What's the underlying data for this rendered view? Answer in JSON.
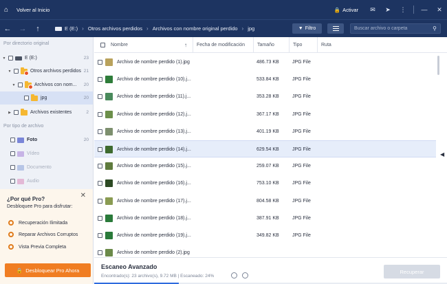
{
  "titlebar": {
    "title": "Volver al Inicio",
    "activate": "Activar"
  },
  "navbar": {
    "crumbs": [
      "E (E:)",
      "Otros archivos perdidos",
      "Archivos con nombre original perdido",
      "jpg"
    ],
    "filter_label": "Filtro",
    "search_placeholder": "Buscar archivo o carpeta"
  },
  "sidebar": {
    "section_original": "Por directorio original",
    "tree": [
      {
        "label": "E (E:)",
        "count": "23"
      },
      {
        "label": "Otros archivos perdidos",
        "count": "21"
      },
      {
        "label": "Archivos con nom...",
        "count": "20"
      },
      {
        "label": "jpg",
        "count": "20"
      },
      {
        "label": "Archivos existentes",
        "count": "2"
      }
    ],
    "section_type": "Por tipo de archivo",
    "types": [
      {
        "label": "Foto",
        "count": "20",
        "color": "#7a86d8"
      },
      {
        "label": "Vídeo",
        "count": "",
        "color": "#c7b4e6"
      },
      {
        "label": "Documento",
        "count": "",
        "color": "#b7c5e6"
      },
      {
        "label": "Audio",
        "count": "",
        "color": "#e3b9d6"
      }
    ]
  },
  "promo": {
    "title": "¿Por qué Pro?",
    "subtitle": "Desbloquee Pro para disfrutar:",
    "features": [
      "Recuperación Ilimitada",
      "Reparar Archivos Corruptos",
      "Vista Previa Completa"
    ],
    "unlock_label": "Desbloquear Pro Ahora"
  },
  "table": {
    "columns": [
      "Nombre",
      "Fecha de modificación",
      "Tamaño",
      "Tipo",
      "Ruta"
    ],
    "rows": [
      {
        "name": "Archivo de nombre perdido (1).jpg",
        "size": "486.73 KB",
        "type": "JPG File",
        "thumb": "#b9a25c"
      },
      {
        "name": "Archivo de nombre perdido (10).j...",
        "size": "533.84 KB",
        "type": "JPG File",
        "thumb": "#2f7d3a"
      },
      {
        "name": "Archivo de nombre perdido (11).j...",
        "size": "353.28 KB",
        "type": "JPG File",
        "thumb": "#4a8a5c"
      },
      {
        "name": "Archivo de nombre perdido (12).j...",
        "size": "367.17 KB",
        "type": "JPG File",
        "thumb": "#6c8f4a"
      },
      {
        "name": "Archivo de nombre perdido (13).j...",
        "size": "401.19 KB",
        "type": "JPG File",
        "thumb": "#7d8f6e"
      },
      {
        "name": "Archivo de nombre perdido (14).j...",
        "size": "629.54 KB",
        "type": "JPG File",
        "thumb": "#3e6b2f"
      },
      {
        "name": "Archivo de nombre perdido (15).j...",
        "size": "259.07 KB",
        "type": "JPG File",
        "thumb": "#5f7b3d"
      },
      {
        "name": "Archivo de nombre perdido (16).j...",
        "size": "753.10 KB",
        "type": "JPG File",
        "thumb": "#2d4a24"
      },
      {
        "name": "Archivo de nombre perdido (17).j...",
        "size": "804.58 KB",
        "type": "JPG File",
        "thumb": "#8a9b52"
      },
      {
        "name": "Archivo de nombre perdido (18).j...",
        "size": "387.91 KB",
        "type": "JPG File",
        "thumb": "#2a7a3a"
      },
      {
        "name": "Archivo de nombre perdido (19).j...",
        "size": "349.82 KB",
        "type": "JPG File",
        "thumb": "#2a7a3a"
      },
      {
        "name": "Archivo de nombre perdido (2).jpg",
        "size": "",
        "type": "",
        "thumb": "#6b8a4a"
      }
    ]
  },
  "bottom": {
    "title": "Escaneo Avanzado",
    "status": "Encontrado(s): 23 archivo(s), 9.72 MB | Escaneado: 24%",
    "progress": 0.24,
    "recover_label": "Recuperar"
  }
}
